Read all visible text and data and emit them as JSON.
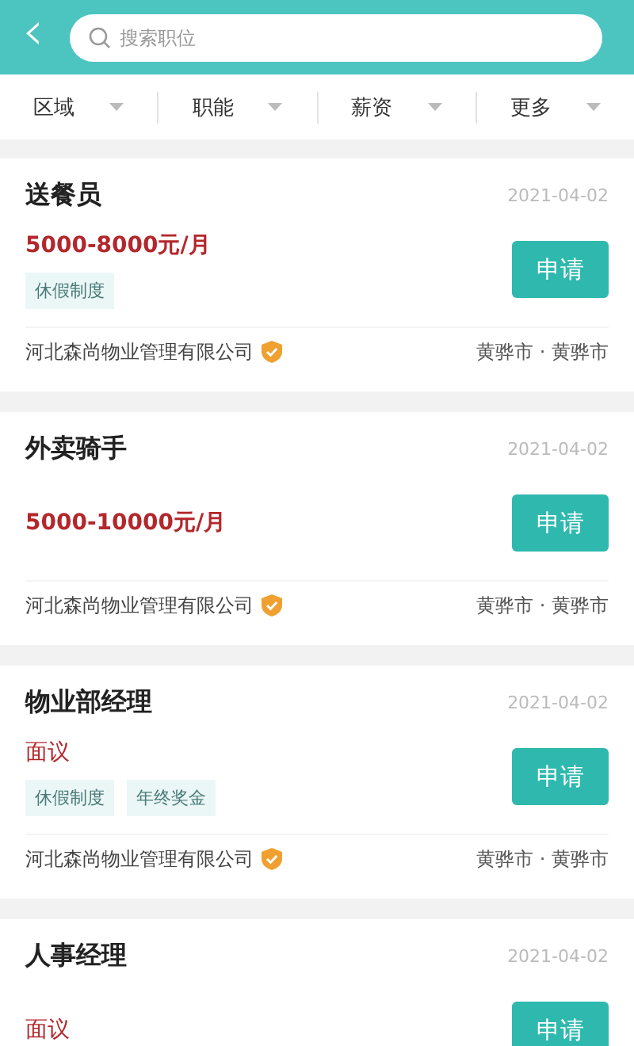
{
  "header": {
    "back": "‹",
    "search": {
      "placeholder": "搜索职位"
    }
  },
  "filters": [
    {
      "label": "区域"
    },
    {
      "label": "职能"
    },
    {
      "label": "薪资"
    },
    {
      "label": "更多"
    }
  ],
  "jobs": [
    {
      "title": "送餐员",
      "date": "2021-04-02",
      "salary": "5000-8000元/月",
      "tags": [
        "休假制度"
      ],
      "apply": "申请",
      "company": "河北森尚物业管理有限公司",
      "verified": true,
      "location": "黄骅市 · 黄骅市"
    },
    {
      "title": "外卖骑手",
      "date": "2021-04-02",
      "salary": "5000-10000元/月",
      "apply": "申请",
      "company": "河北森尚物业管理有限公司",
      "verified": true,
      "location": "黄骅市 · 黄骅市"
    },
    {
      "title": "物业部经理",
      "date": "2021-04-02",
      "salary": "面议",
      "tags": [
        "休假制度",
        "年终奖金"
      ],
      "apply": "申请",
      "company": "河北森尚物业管理有限公司",
      "verified": true,
      "location": "黄骅市 · 黄骅市"
    },
    {
      "title": "人事经理",
      "date": "2021-04-02",
      "salary": "面议",
      "apply": "申请"
    }
  ]
}
